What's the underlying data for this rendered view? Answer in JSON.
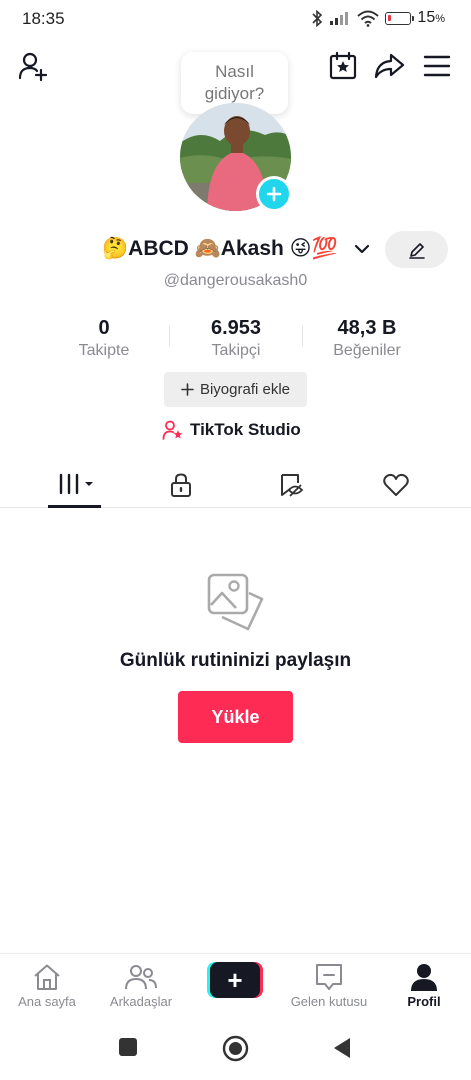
{
  "status_bar": {
    "time": "18:35",
    "battery_percent": "15",
    "battery_unit": "%",
    "battery_level": 0.15,
    "battery_color": "#e8343c"
  },
  "header": {
    "add_friend_icon": "person-add-icon",
    "calendar_icon": "calendar-star-icon",
    "share_icon": "share-arrow-icon",
    "menu_icon": "hamburger-menu-icon",
    "bubble_text_line1": "Nasıl",
    "bubble_text_line2": "gidiyor?"
  },
  "profile": {
    "display_name": "🤔ABCD 🙈Akash 😜💯",
    "username": "@dangerousakash0",
    "bio_button_label": "Biyografi ekle",
    "studio_label": "TikTok Studio"
  },
  "stats": [
    {
      "value": "0",
      "label": "Takipte"
    },
    {
      "value": "6.953",
      "label": "Takipçi"
    },
    {
      "value": "48,3 B",
      "label": "Beğeniler"
    }
  ],
  "tabs": [
    {
      "icon": "grid-videos-icon",
      "active": true
    },
    {
      "icon": "lock-icon",
      "active": false
    },
    {
      "icon": "bookmark-hidden-icon",
      "active": false
    },
    {
      "icon": "heart-icon",
      "active": false
    }
  ],
  "empty_state": {
    "title": "Günlük rutininizi paylaşın",
    "button_label": "Yükle",
    "icon": "photo-stack-icon"
  },
  "bottom_nav": [
    {
      "label": "Ana sayfa",
      "icon": "home-icon",
      "active": false
    },
    {
      "label": "Arkadaşlar",
      "icon": "friends-icon",
      "active": false
    },
    {
      "label": "",
      "icon": "create-plus-icon",
      "active": false
    },
    {
      "label": "Gelen kutusu",
      "icon": "inbox-icon",
      "active": false
    },
    {
      "label": "Profil",
      "icon": "profile-icon",
      "active": true
    }
  ],
  "colors": {
    "accent": "#fe2c55",
    "cyan": "#25f4ee",
    "avatar_add": "#20d5ec",
    "text_secondary": "#8a8b91"
  }
}
